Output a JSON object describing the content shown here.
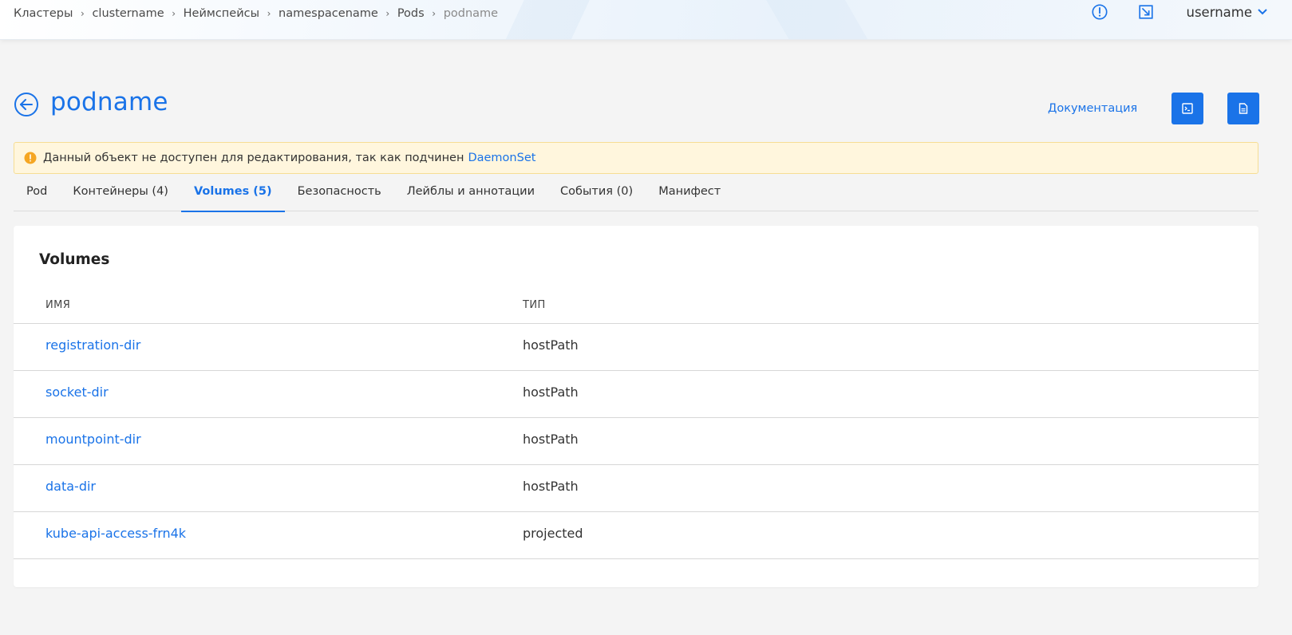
{
  "breadcrumb": [
    "Кластеры",
    "clustername",
    "Неймспейсы",
    "namespacename",
    "Pods",
    "podname"
  ],
  "topbar": {
    "user": "username"
  },
  "header": {
    "title": "podname",
    "docs_link": "Документация"
  },
  "banner": {
    "text": "Данный объект не доступен для редактирования, так как подчинен",
    "link": "DaemonSet"
  },
  "tabs": [
    "Pod",
    "Контейнеры (4)",
    "Volumes (5)",
    "Безопасность",
    "Лейблы и аннотации",
    "События (0)",
    "Манифест"
  ],
  "active_tab": "Volumes (5)",
  "volumes": {
    "title": "Volumes",
    "columns": {
      "name": "ИМЯ",
      "type": "ТИП"
    },
    "rows": [
      {
        "name": "registration-dir",
        "type": "hostPath"
      },
      {
        "name": "socket-dir",
        "type": "hostPath"
      },
      {
        "name": "mountpoint-dir",
        "type": "hostPath"
      },
      {
        "name": "data-dir",
        "type": "hostPath"
      },
      {
        "name": "kube-api-access-frn4k",
        "type": "projected"
      }
    ]
  },
  "colors": {
    "accent": "#1a73e8",
    "warning_bg": "#fff6dd",
    "warning_icon": "#f5a623"
  },
  "icons": {
    "alert": "alert-circle-icon",
    "external": "open-external-icon",
    "back": "arrow-left-circle-icon",
    "terminal": "terminal-icon",
    "file": "file-icon"
  }
}
